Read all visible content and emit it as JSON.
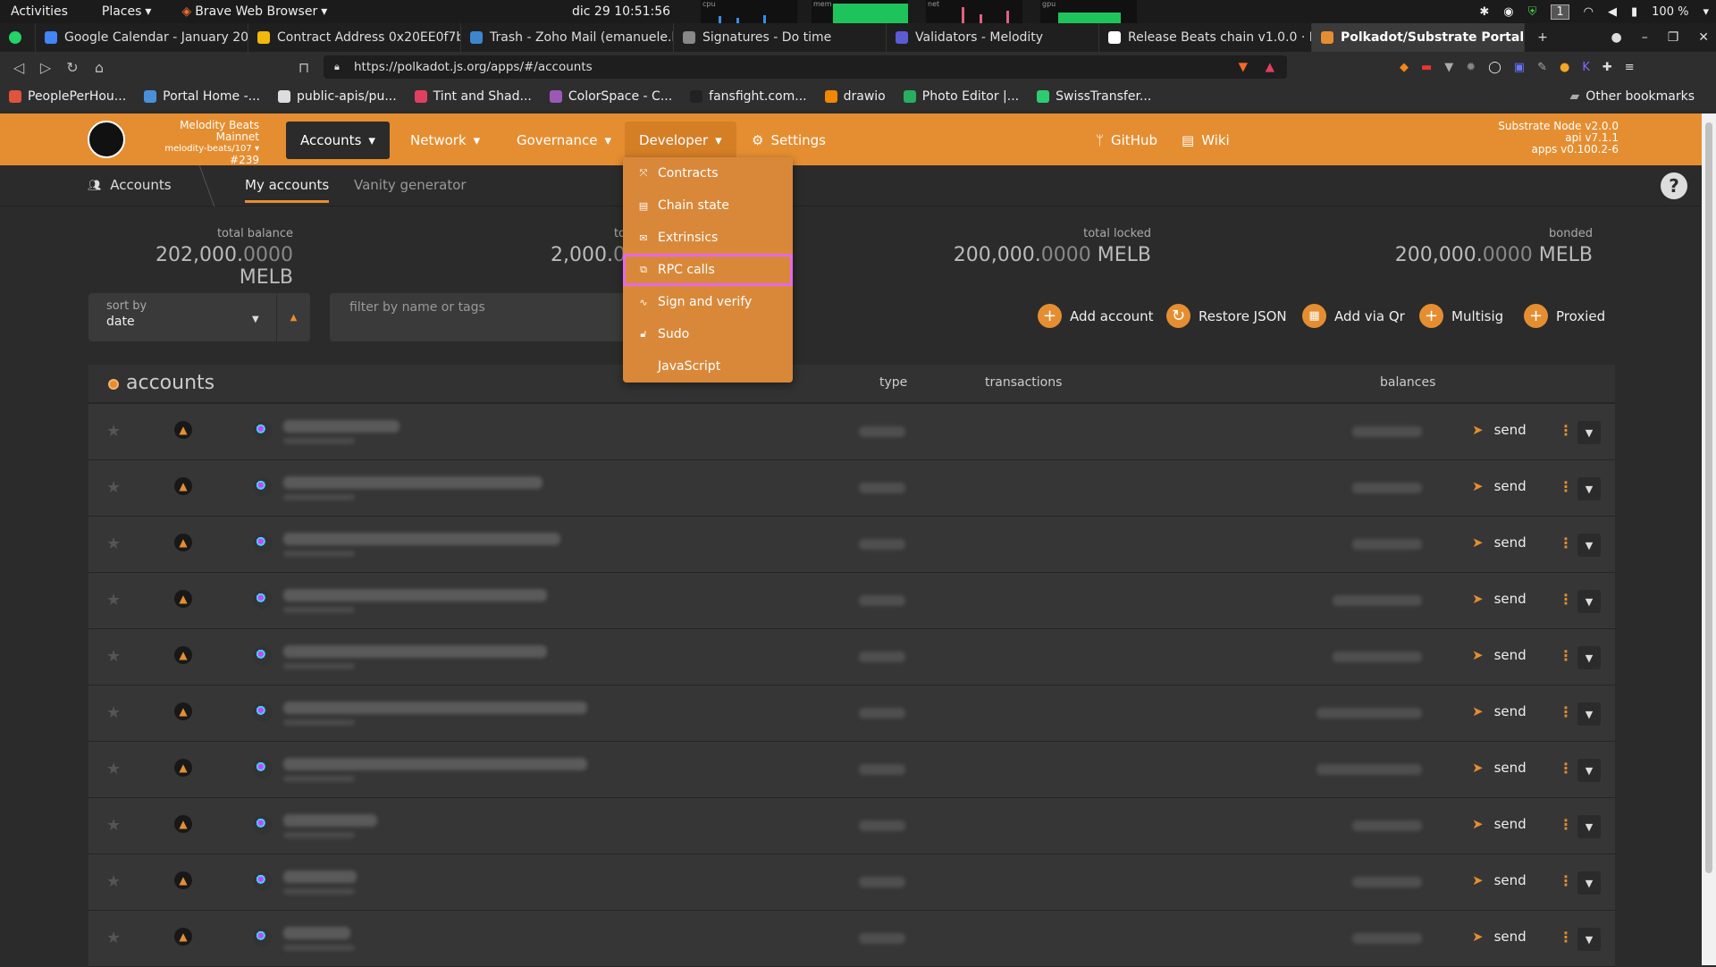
{
  "system": {
    "activities": "Activities",
    "places": "Places",
    "browser_menu": "Brave Web Browser",
    "clock": "dic 29  10:51:56",
    "graphs": [
      "cpu",
      "mem",
      "net",
      "gpu"
    ],
    "workspace": "1",
    "battery": "100 %"
  },
  "tabs": [
    {
      "label": "Google Calendar - January 20",
      "color": "#4285f4"
    },
    {
      "label": "Contract Address 0x20EE0f7b",
      "color": "#f0b90b"
    },
    {
      "label": "Trash - Zoho Mail (emanuele.b",
      "color": "#3d86ce"
    },
    {
      "label": "Signatures - Do time",
      "color": "#888888"
    },
    {
      "label": "Validators - Melodity",
      "color": "#5b5bd6"
    },
    {
      "label": "Release Beats chain v1.0.0 · D",
      "color": "#ffffff"
    },
    {
      "label": "Polkadot/Substrate Portal",
      "color": "#e58e31",
      "active": true
    }
  ],
  "url": "https://polkadot.js.org/apps/#/accounts",
  "bookmarks": [
    {
      "label": "PeoplePerHou...",
      "color": "#e0533d"
    },
    {
      "label": "Portal Home -...",
      "color": "#4a90d9"
    },
    {
      "label": "public-apis/pu...",
      "color": "#dddddd"
    },
    {
      "label": "Tint and Shad...",
      "color": "#e04060"
    },
    {
      "label": "ColorSpace - C...",
      "color": "#9b59b6"
    },
    {
      "label": "fansfight.com...",
      "color": "#222222"
    },
    {
      "label": "drawio",
      "color": "#f08705"
    },
    {
      "label": "Photo Editor |...",
      "color": "#27ae60"
    },
    {
      "label": "SwissTransfer...",
      "color": "#2ecc71"
    }
  ],
  "other_bookmarks": "Other bookmarks",
  "app": {
    "chain_name": "Melodity Beats Mainnet",
    "chain_version": "melodity-beats/107",
    "block": "#239",
    "menus": [
      "Accounts",
      "Network",
      "Governance",
      "Developer"
    ],
    "settings": "Settings",
    "github": "GitHub",
    "wiki": "Wiki",
    "version": [
      "Substrate Node v2.0.0",
      "api v7.1.1",
      "apps v0.100.2-6"
    ],
    "accent": "#e58e31"
  },
  "subnav": {
    "section": "Accounts",
    "tabs": [
      "My accounts",
      "Vanity generator"
    ]
  },
  "summary": [
    {
      "label": "total balance",
      "int": "202,000.",
      "dec": "0000",
      "unit": "MELB"
    },
    {
      "label": "to",
      "int": "2,000.",
      "dec": "0",
      "unit": ""
    },
    {
      "label": "total locked",
      "int": "200,000.",
      "dec": "0000",
      "unit": "MELB"
    },
    {
      "label": "bonded",
      "int": "200,000.",
      "dec": "0000",
      "unit": "MELB"
    }
  ],
  "sort": {
    "label": "sort by",
    "value": "date"
  },
  "filter_placeholder": "filter by name or tags",
  "actions": [
    "Add account",
    "Restore JSON",
    "Add via Qr",
    "Multisig",
    "Proxied"
  ],
  "table": {
    "title": "accounts",
    "columns": [
      "type",
      "transactions",
      "balances"
    ],
    "send_label": "send",
    "row_count": 10
  },
  "developer_menu": [
    {
      "label": "Contracts",
      "icon": "compress-icon"
    },
    {
      "label": "Chain state",
      "icon": "database-icon"
    },
    {
      "label": "Extrinsics",
      "icon": "envelope-icon"
    },
    {
      "label": "RPC calls",
      "icon": "network-wired-icon",
      "highlighted": true
    },
    {
      "label": "Sign and verify",
      "icon": "signature-icon"
    },
    {
      "label": "Sudo",
      "icon": "unlock-icon"
    },
    {
      "label": "JavaScript",
      "icon": "code-icon"
    }
  ]
}
